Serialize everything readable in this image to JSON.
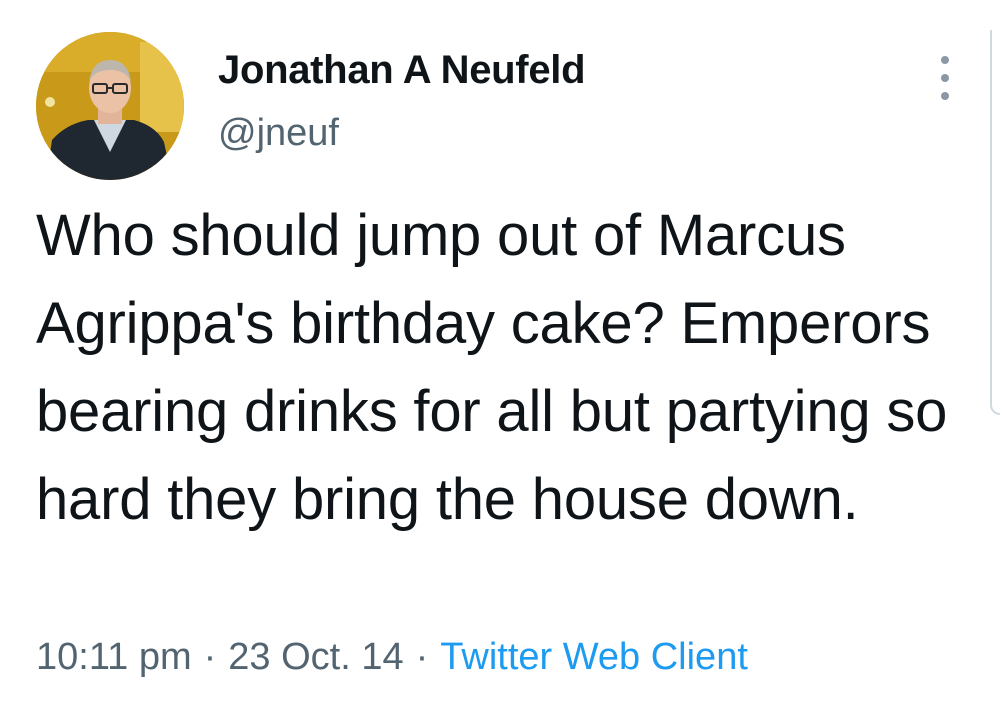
{
  "author": {
    "display_name": "Jonathan A Neufeld",
    "handle": "@jneuf",
    "avatar_icon": "profile-photo"
  },
  "tweet": {
    "text": "Who should jump out of Marcus Agrippa's birthday cake? Emperors bearing drinks for all but partying so hard they bring the house down.",
    "time": "10:11 pm",
    "date": "23 Oct. 14",
    "separator": "·",
    "client": "Twitter Web Client"
  },
  "colors": {
    "text": "#0f1419",
    "secondary": "#536471",
    "link": "#1d9bf0",
    "avatar_bg": "#c99a1a"
  },
  "icons": {
    "more": "vertical-ellipsis-icon"
  }
}
